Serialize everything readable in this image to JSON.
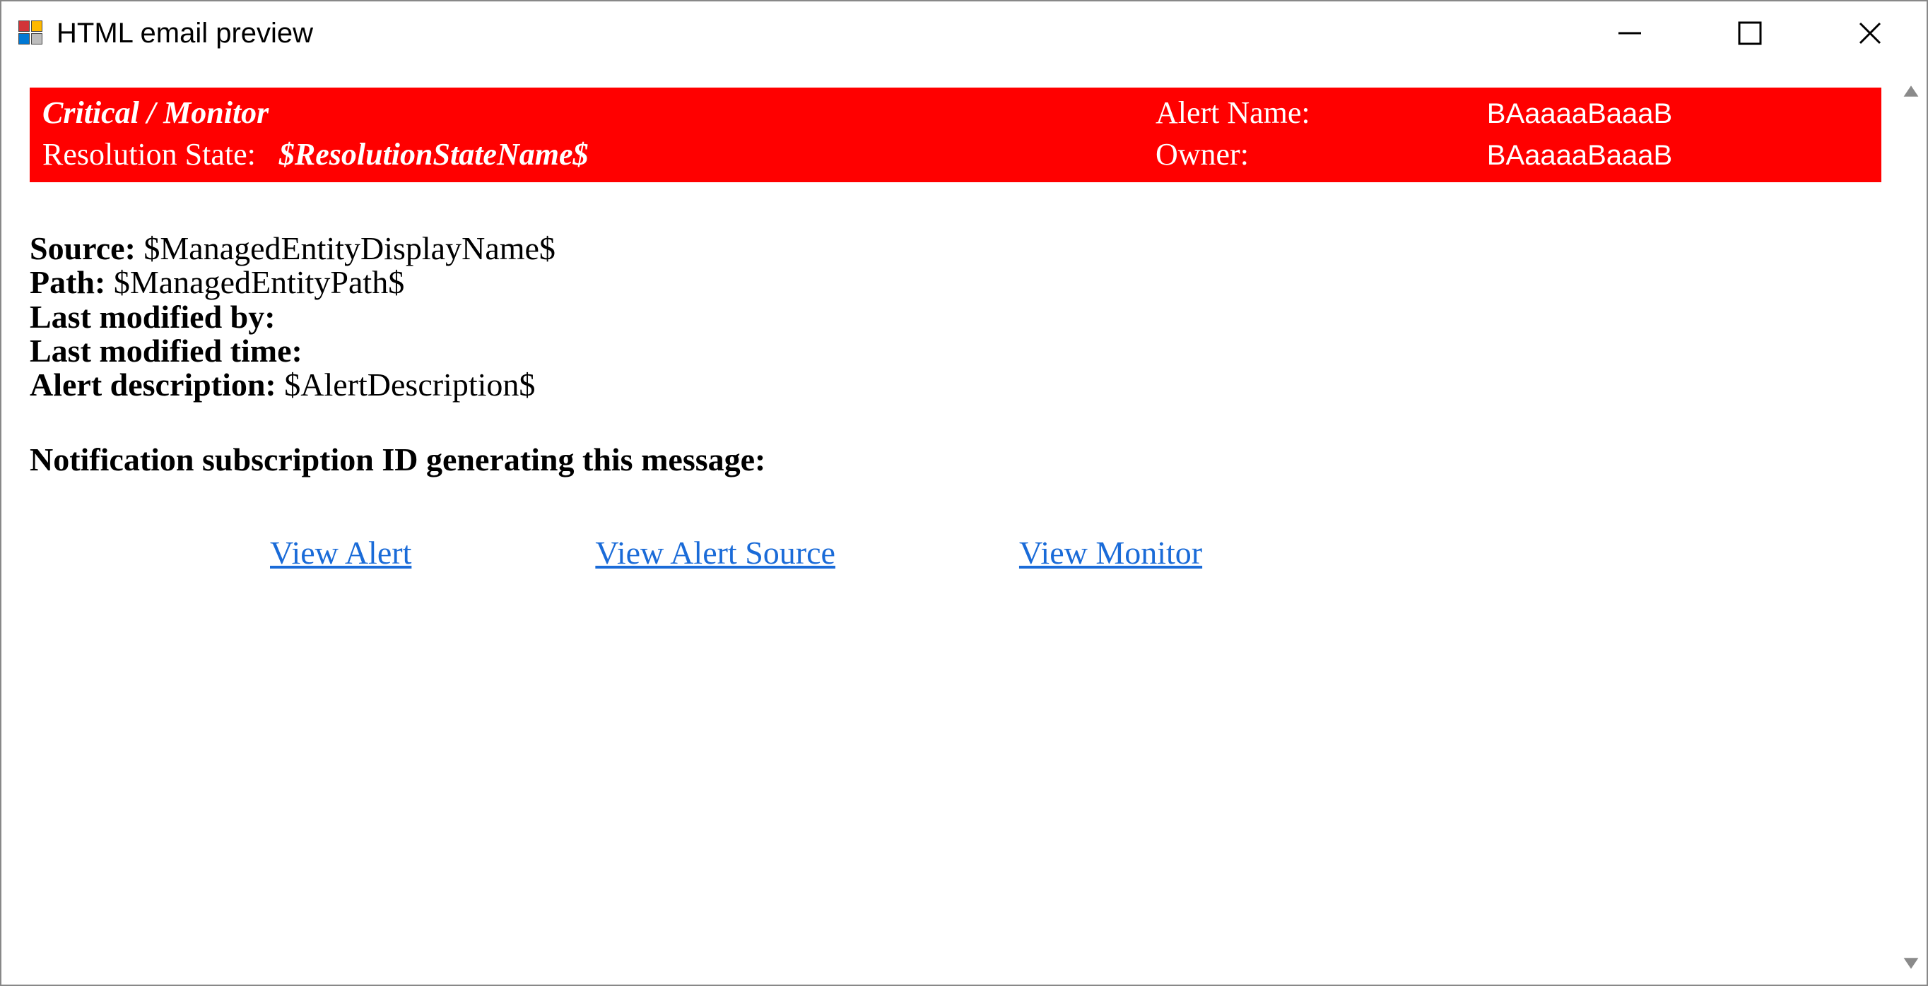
{
  "window": {
    "title": "HTML email preview"
  },
  "header": {
    "severity": "Critical / Monitor",
    "alert_name_label": "Alert Name:",
    "alert_name_value": "BAaaaaBaaaB",
    "resolution_state_label": "Resolution State:",
    "resolution_state_value": "$ResolutionStateName$",
    "owner_label": "Owner:",
    "owner_value": "BAaaaaBaaaB"
  },
  "fields": {
    "source_label": "Source:",
    "source_value": "$ManagedEntityDisplayName$",
    "path_label": "Path:",
    "path_value": "$ManagedEntityPath$",
    "last_modified_by_label": "Last modified by:",
    "last_modified_by_value": "",
    "last_modified_time_label": "Last modified time:",
    "last_modified_time_value": "",
    "alert_description_label": "Alert description:",
    "alert_description_value": "$AlertDescription$",
    "subscription_label": "Notification subscription ID generating this message:",
    "subscription_value": ""
  },
  "links": {
    "view_alert": "View Alert",
    "view_alert_source": "View Alert Source",
    "view_monitor": "View Monitor"
  },
  "colors": {
    "header_bg": "#ff0000",
    "link": "#1a6bd8"
  }
}
